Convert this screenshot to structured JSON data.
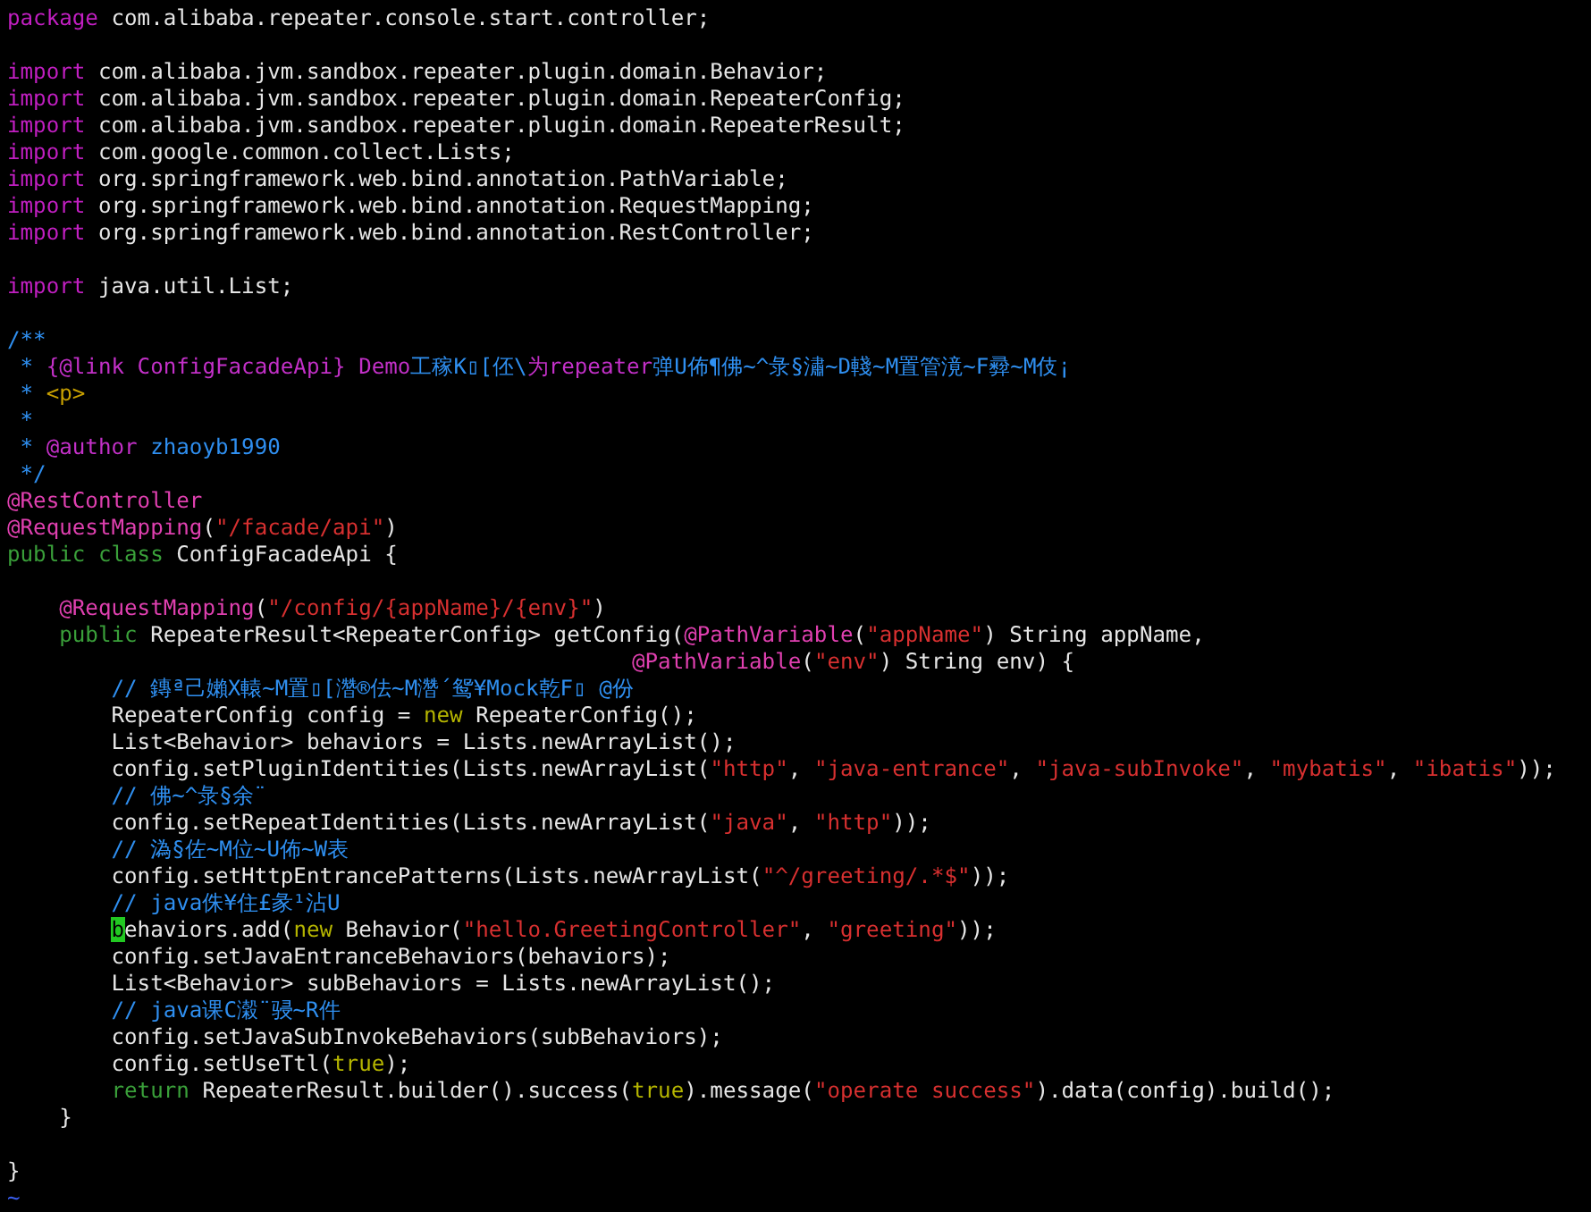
{
  "editor": {
    "lines": [
      {
        "kind": "code",
        "tokens": [
          {
            "kind": "keyword",
            "text": "package"
          },
          {
            "kind": "plain",
            "text": " com.alibaba.repeater.console.start.controller;"
          }
        ]
      },
      {
        "kind": "blank"
      },
      {
        "kind": "code",
        "tokens": [
          {
            "kind": "keyword",
            "text": "import"
          },
          {
            "kind": "plain",
            "text": " com.alibaba.jvm.sandbox.repeater.plugin.domain.Behavior;"
          }
        ]
      },
      {
        "kind": "code",
        "tokens": [
          {
            "kind": "keyword",
            "text": "import"
          },
          {
            "kind": "plain",
            "text": " com.alibaba.jvm.sandbox.repeater.plugin.domain.RepeaterConfig;"
          }
        ]
      },
      {
        "kind": "code",
        "tokens": [
          {
            "kind": "keyword",
            "text": "import"
          },
          {
            "kind": "plain",
            "text": " com.alibaba.jvm.sandbox.repeater.plugin.domain.RepeaterResult;"
          }
        ]
      },
      {
        "kind": "code",
        "tokens": [
          {
            "kind": "keyword",
            "text": "import"
          },
          {
            "kind": "plain",
            "text": " com.google.common.collect.Lists;"
          }
        ]
      },
      {
        "kind": "code",
        "tokens": [
          {
            "kind": "keyword",
            "text": "import"
          },
          {
            "kind": "plain",
            "text": " org.springframework.web.bind.annotation.PathVariable;"
          }
        ]
      },
      {
        "kind": "code",
        "tokens": [
          {
            "kind": "keyword",
            "text": "import"
          },
          {
            "kind": "plain",
            "text": " org.springframework.web.bind.annotation.RequestMapping;"
          }
        ]
      },
      {
        "kind": "code",
        "tokens": [
          {
            "kind": "keyword",
            "text": "import"
          },
          {
            "kind": "plain",
            "text": " org.springframework.web.bind.annotation.RestController;"
          }
        ]
      },
      {
        "kind": "blank"
      },
      {
        "kind": "code",
        "tokens": [
          {
            "kind": "keyword",
            "text": "import"
          },
          {
            "kind": "plain",
            "text": " java.util.List;"
          }
        ]
      },
      {
        "kind": "blank"
      },
      {
        "kind": "code",
        "tokens": [
          {
            "kind": "comment",
            "text": "/**"
          }
        ]
      },
      {
        "kind": "code",
        "tokens": [
          {
            "kind": "comment",
            "text": " * "
          },
          {
            "kind": "tag",
            "text": "{@link ConfigFacadeApi} Demo"
          },
          {
            "kind": "comment",
            "text": "工稼K▯[伾\\"
          },
          {
            "kind": "tag",
            "text": "为repeater"
          },
          {
            "kind": "comment",
            "text": "弹U佈¶佛~^彔§潚~D輚~M置管滰~F彛~M伎¡"
          }
        ]
      },
      {
        "kind": "code",
        "tokens": [
          {
            "kind": "comment",
            "text": " * "
          },
          {
            "kind": "html",
            "text": "<p>"
          }
        ]
      },
      {
        "kind": "code",
        "tokens": [
          {
            "kind": "comment",
            "text": " *"
          }
        ]
      },
      {
        "kind": "code",
        "tokens": [
          {
            "kind": "comment",
            "text": " * "
          },
          {
            "kind": "tag",
            "text": "@author"
          },
          {
            "kind": "comment",
            "text": " zhaoyb1990"
          }
        ]
      },
      {
        "kind": "code",
        "tokens": [
          {
            "kind": "comment",
            "text": " */"
          }
        ]
      },
      {
        "kind": "code",
        "tokens": [
          {
            "kind": "annotation",
            "text": "@RestController"
          }
        ]
      },
      {
        "kind": "code",
        "tokens": [
          {
            "kind": "annotation",
            "text": "@RequestMapping"
          },
          {
            "kind": "plain",
            "text": "("
          },
          {
            "kind": "string",
            "text": "\"/facade/api\""
          },
          {
            "kind": "plain",
            "text": ")"
          }
        ]
      },
      {
        "kind": "code",
        "tokens": [
          {
            "kind": "modifier",
            "text": "public class"
          },
          {
            "kind": "plain",
            "text": " ConfigFacadeApi {"
          }
        ]
      },
      {
        "kind": "blank"
      },
      {
        "kind": "code",
        "tokens": [
          {
            "kind": "annotation",
            "text": "    @RequestMapping"
          },
          {
            "kind": "plain",
            "text": "("
          },
          {
            "kind": "string",
            "text": "\"/config/{appName}/{env}\""
          },
          {
            "kind": "plain",
            "text": ")"
          }
        ]
      },
      {
        "kind": "code",
        "tokens": [
          {
            "kind": "modifier",
            "text": "    public"
          },
          {
            "kind": "plain",
            "text": " RepeaterResult<RepeaterConfig> getConfig("
          },
          {
            "kind": "annotation",
            "text": "@PathVariable"
          },
          {
            "kind": "plain",
            "text": "("
          },
          {
            "kind": "string",
            "text": "\"appName\""
          },
          {
            "kind": "plain",
            "text": ") String appName,"
          }
        ]
      },
      {
        "kind": "code",
        "tokens": [
          {
            "kind": "annotation",
            "text": "                                                @PathVariable"
          },
          {
            "kind": "plain",
            "text": "("
          },
          {
            "kind": "string",
            "text": "\"env\""
          },
          {
            "kind": "plain",
            "text": ") String env) {"
          }
        ]
      },
      {
        "kind": "code",
        "tokens": [
          {
            "kind": "comment",
            "text": "        // 鏄ª己嬾X轅~M置▯[濳®佉~M濳´鸳¥Mock乾F▯ @份"
          }
        ]
      },
      {
        "kind": "code",
        "tokens": [
          {
            "kind": "plain",
            "text": "        RepeaterConfig config = "
          },
          {
            "kind": "literal",
            "text": "new"
          },
          {
            "kind": "plain",
            "text": " RepeaterConfig();"
          }
        ]
      },
      {
        "kind": "code",
        "tokens": [
          {
            "kind": "plain",
            "text": "        List<Behavior> behaviors = Lists.newArrayList();"
          }
        ]
      },
      {
        "kind": "code",
        "tokens": [
          {
            "kind": "plain",
            "text": "        config.setPluginIdentities(Lists.newArrayList("
          },
          {
            "kind": "string",
            "text": "\"http\""
          },
          {
            "kind": "plain",
            "text": ", "
          },
          {
            "kind": "string",
            "text": "\"java-entrance\""
          },
          {
            "kind": "plain",
            "text": ", "
          },
          {
            "kind": "string",
            "text": "\"java-subInvoke\""
          },
          {
            "kind": "plain",
            "text": ", "
          },
          {
            "kind": "string",
            "text": "\"mybatis\""
          },
          {
            "kind": "plain",
            "text": ", "
          },
          {
            "kind": "string",
            "text": "\"ibatis\""
          },
          {
            "kind": "plain",
            "text": "));"
          }
        ]
      },
      {
        "kind": "code",
        "tokens": [
          {
            "kind": "comment",
            "text": "        // 佛~^彔§余¨"
          }
        ]
      },
      {
        "kind": "code",
        "tokens": [
          {
            "kind": "plain",
            "text": "        config.setRepeatIdentities(Lists.newArrayList("
          },
          {
            "kind": "string",
            "text": "\"java\""
          },
          {
            "kind": "plain",
            "text": ", "
          },
          {
            "kind": "string",
            "text": "\"http\""
          },
          {
            "kind": "plain",
            "text": "));"
          }
        ]
      },
      {
        "kind": "code",
        "tokens": [
          {
            "kind": "comment",
            "text": "        // 溈§佐~M位~U佈~W表"
          }
        ]
      },
      {
        "kind": "code",
        "tokens": [
          {
            "kind": "plain",
            "text": "        config.setHttpEntrancePatterns(Lists.newArrayList("
          },
          {
            "kind": "string",
            "text": "\"^/greeting/.*$\""
          },
          {
            "kind": "plain",
            "text": "));"
          }
        ]
      },
      {
        "kind": "code",
        "tokens": [
          {
            "kind": "comment",
            "text": "        // java侏¥住£彖¹沾U"
          }
        ]
      },
      {
        "kind": "code",
        "tokens": [
          {
            "kind": "cursor",
            "text": "        b"
          },
          {
            "kind": "plain",
            "text": "ehaviors.add("
          },
          {
            "kind": "literal",
            "text": "new"
          },
          {
            "kind": "plain",
            "text": " Behavior("
          },
          {
            "kind": "string",
            "text": "\"hello.GreetingController\""
          },
          {
            "kind": "plain",
            "text": ", "
          },
          {
            "kind": "string",
            "text": "\"greeting\""
          },
          {
            "kind": "plain",
            "text": "));"
          }
        ]
      },
      {
        "kind": "code",
        "tokens": [
          {
            "kind": "plain",
            "text": "        config.setJavaEntranceBehaviors(behaviors);"
          }
        ]
      },
      {
        "kind": "code",
        "tokens": [
          {
            "kind": "plain",
            "text": "        List<Behavior> subBehaviors = Lists.newArrayList();"
          }
        ]
      },
      {
        "kind": "code",
        "tokens": [
          {
            "kind": "comment",
            "text": "        // java课C濲¨骎~R件"
          }
        ]
      },
      {
        "kind": "code",
        "tokens": [
          {
            "kind": "plain",
            "text": "        config.setJavaSubInvokeBehaviors(subBehaviors);"
          }
        ]
      },
      {
        "kind": "code",
        "tokens": [
          {
            "kind": "plain",
            "text": "        config.setUseTtl("
          },
          {
            "kind": "literal",
            "text": "true"
          },
          {
            "kind": "plain",
            "text": ");"
          }
        ]
      },
      {
        "kind": "code",
        "tokens": [
          {
            "kind": "modifier",
            "text": "        return"
          },
          {
            "kind": "plain",
            "text": " RepeaterResult.builder().success("
          },
          {
            "kind": "literal",
            "text": "true"
          },
          {
            "kind": "plain",
            "text": ").message("
          },
          {
            "kind": "string",
            "text": "\"operate success\""
          },
          {
            "kind": "plain",
            "text": ").data(config).build();"
          }
        ]
      },
      {
        "kind": "code",
        "tokens": [
          {
            "kind": "plain",
            "text": "    }"
          }
        ]
      },
      {
        "kind": "blank"
      },
      {
        "kind": "code",
        "tokens": [
          {
            "kind": "plain",
            "text": "}"
          }
        ]
      },
      {
        "kind": "code",
        "tokens": [
          {
            "kind": "tilde",
            "text": "~"
          }
        ]
      }
    ]
  }
}
